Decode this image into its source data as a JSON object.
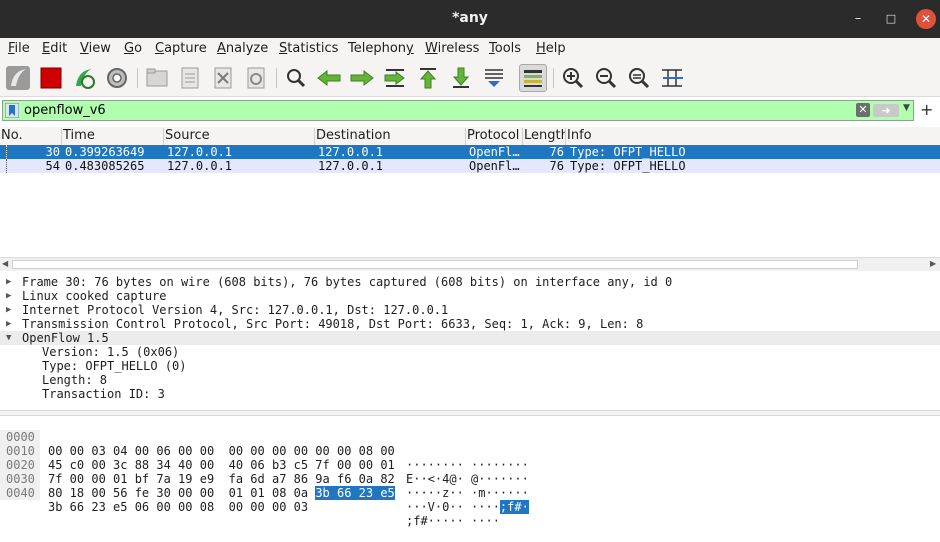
{
  "window": {
    "title": "*any"
  },
  "menu": [
    "File",
    "Edit",
    "View",
    "Go",
    "Capture",
    "Analyze",
    "Statistics",
    "Telephony",
    "Wireless",
    "Tools",
    "Help"
  ],
  "menu_mnemonics": [
    "F",
    "E",
    "V",
    "G",
    "C",
    "A",
    "S",
    "y",
    "W",
    "T",
    "H"
  ],
  "filter": {
    "value": "openflow_v6"
  },
  "columns": [
    "No.",
    "Time",
    "Source",
    "Destination",
    "Protocol",
    "Length",
    "Info"
  ],
  "packets": [
    {
      "no": "30",
      "time": "0.399263649",
      "source": "127.0.0.1",
      "destination": "127.0.0.1",
      "protocol": "OpenFl…",
      "length": "76",
      "info": "Type: OFPT_HELLO"
    },
    {
      "no": "54",
      "time": "0.483085265",
      "source": "127.0.0.1",
      "destination": "127.0.0.1",
      "protocol": "OpenFl…",
      "length": "76",
      "info": "Type: OFPT_HELLO"
    }
  ],
  "details": [
    {
      "text": "Frame 30: 76 bytes on wire (608 bits), 76 bytes captured (608 bits) on interface any, id 0",
      "expanded": false
    },
    {
      "text": "Linux cooked capture",
      "expanded": false
    },
    {
      "text": "Internet Protocol Version 4, Src: 127.0.0.1, Dst: 127.0.0.1",
      "expanded": false
    },
    {
      "text": "Transmission Control Protocol, Src Port: 49018, Dst Port: 6633, Seq: 1, Ack: 9, Len: 8",
      "expanded": false
    },
    {
      "text": "OpenFlow 1.5",
      "expanded": true
    },
    {
      "text": "Version: 1.5 (0x06)",
      "child": true
    },
    {
      "text": "Type: OFPT_HELLO (0)",
      "child": true
    },
    {
      "text": "Length: 8",
      "child": true
    },
    {
      "text": "Transaction ID: 3",
      "child": true
    }
  ],
  "bytes": [
    {
      "offset": "0000",
      "hex": "00 00 03 04 00 06 00 00  00 00 00 00 00 00 08 00",
      "ascii": "········ ········"
    },
    {
      "offset": "0010",
      "hex": "45 c0 00 3c 88 34 40 00  40 06 b3 c5 7f 00 00 01",
      "ascii": "E··<·4@· @·······"
    },
    {
      "offset": "0020",
      "hex": "7f 00 00 01 bf 7a 19 e9  fa 6d a7 86 9a f6 0a 82",
      "ascii": "·····z·· ·m······"
    },
    {
      "offset": "0030",
      "hex": "80 18 00 56 fe 30 00 00  01 01 08 0a ",
      "hex_hl": "3b 66 23 e5",
      "ascii": "···V·0·· ····",
      "ascii_hl": ";f#·"
    },
    {
      "offset": "0040",
      "hex": "3b 66 23 e5 06 00 00 08  00 00 00 03",
      "ascii": ";f#····· ····"
    }
  ],
  "colors": {
    "selected_row": "#1f77c2",
    "second_row": "#e7e6ff",
    "filter_bg": "#afffaf",
    "titlebar": "#2b2b2b",
    "close": "#e0513b"
  }
}
